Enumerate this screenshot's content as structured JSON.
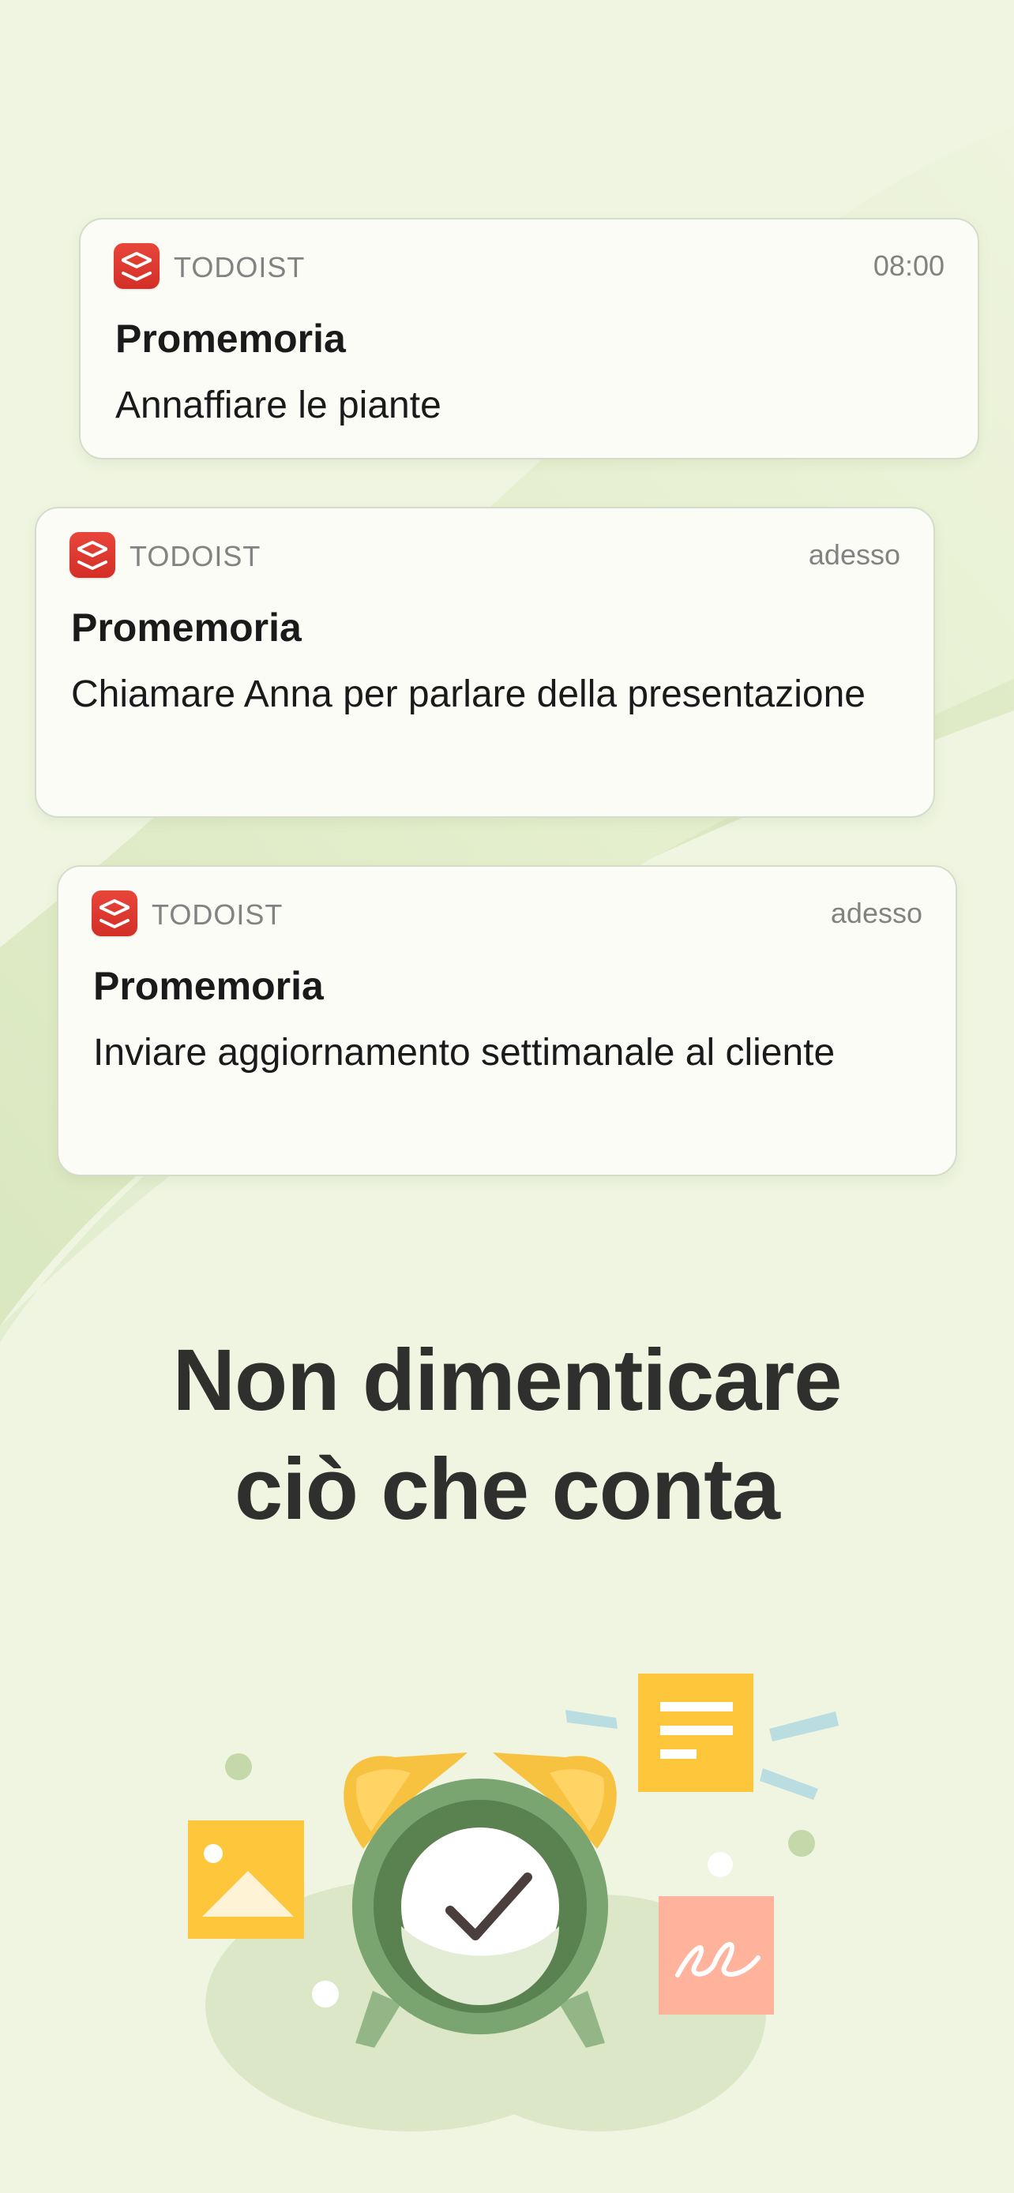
{
  "notifications": [
    {
      "app_name": "TODOIST",
      "time": "08:00",
      "title": "Promemoria",
      "body": "Annaffiare le piante",
      "icon": "todoist-icon"
    },
    {
      "app_name": "TODOIST",
      "time": "adesso",
      "title": "Promemoria",
      "body": "Chiamare Anna per parlare della presentazione",
      "icon": "todoist-icon"
    },
    {
      "app_name": "TODOIST",
      "time": "adesso",
      "title": "Promemoria",
      "body": "Inviare aggiornamento settimanale al cliente",
      "icon": "todoist-icon"
    }
  ],
  "headline": {
    "line1": "Non dimenticare",
    "line2": "ciò che conta"
  },
  "colors": {
    "background": "#eff5e0",
    "brand_red": "#dc3a2f",
    "clock_green": "#5f8a55",
    "bell_yellow": "#f7c23f",
    "note_yellow": "#ffc83d",
    "note_salmon": "#ffb29b"
  },
  "illustration": {
    "icons": [
      "alarm-clock-icon",
      "checkmark-icon",
      "image-note-icon",
      "text-note-icon",
      "signature-note-icon"
    ]
  }
}
